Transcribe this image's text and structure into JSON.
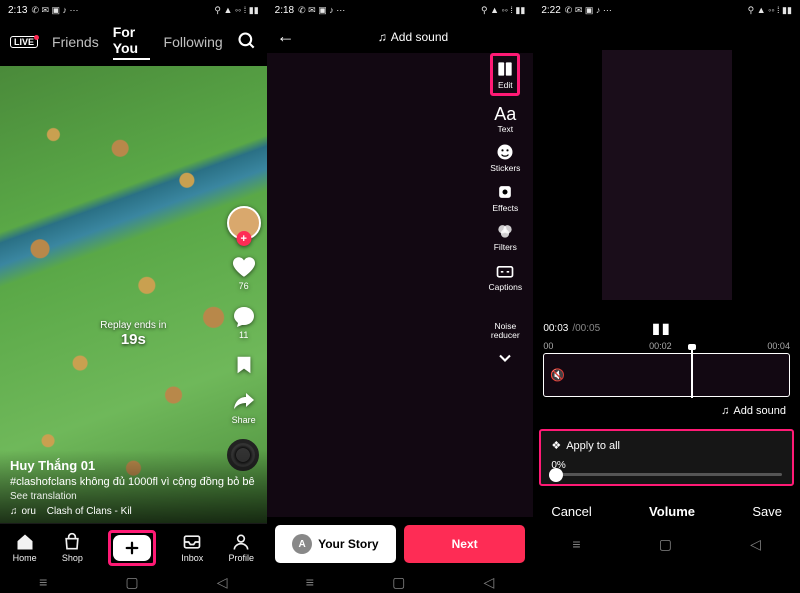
{
  "status": {
    "time1": "2:13",
    "time2": "2:18",
    "time3": "2:22"
  },
  "s1": {
    "tabs": {
      "friends": "Friends",
      "foryou": "For You",
      "following": "Following"
    },
    "replay_label": "Replay ends in",
    "replay_time": "19s",
    "username": "Huy Thắng 01",
    "caption": "#clashofclans không đủ 1000fl vì cộng đồng bỏ bê",
    "see_trans": "See translation",
    "music_prefix": "oru",
    "music": "Clash of Clans - Kil",
    "likes": "76",
    "comments": "11",
    "share_label": "Share",
    "nav": {
      "home": "Home",
      "shop": "Shop",
      "inbox": "Inbox",
      "profile": "Profile"
    }
  },
  "s2": {
    "add_sound": "Add sound",
    "tools": {
      "edit": "Edit",
      "text": "Text",
      "stickers": "Stickers",
      "effects": "Effects",
      "filters": "Filters",
      "captions": "Captions",
      "noise": "Noise reducer"
    },
    "story_av": "A",
    "your_story": "Your Story",
    "next": "Next"
  },
  "s3": {
    "cur": "00:03",
    "tot": "/00:05",
    "ticks": {
      "a": "00",
      "b": "00:02",
      "c": "00:04"
    },
    "add_sound": "Add sound",
    "apply": "Apply to all",
    "pct": "0%",
    "cancel": "Cancel",
    "volume": "Volume",
    "save": "Save"
  }
}
